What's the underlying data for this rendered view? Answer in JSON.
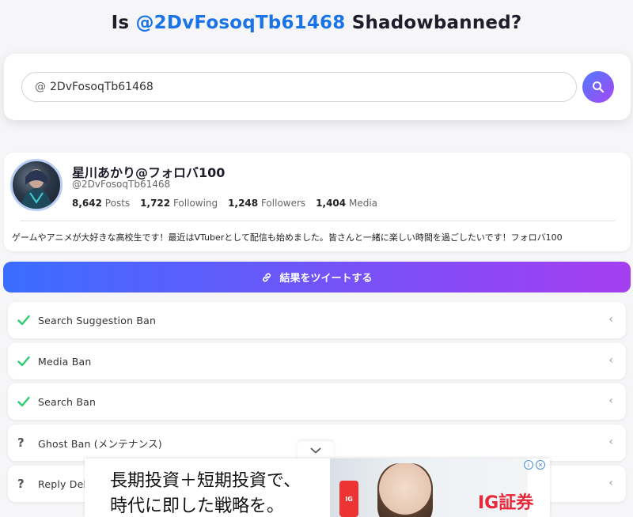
{
  "header": {
    "prefix": "Is",
    "handle": "@2DvFosoqTb61468",
    "suffix": "Shadowbanned?"
  },
  "search": {
    "at_symbol": "@",
    "value": "2DvFosoqTb61468"
  },
  "profile": {
    "display_name": "星川あかり@フォロバ100",
    "screen_name": "@2DvFosoqTb61468",
    "stats": [
      {
        "value": "8,642",
        "label": "Posts"
      },
      {
        "value": "1,722",
        "label": "Following"
      },
      {
        "value": "1,248",
        "label": "Followers"
      },
      {
        "value": "1,404",
        "label": "Media"
      }
    ],
    "bio": "ゲームやアニメが大好きな高校生です！最近はVTuberとして配信も始めました。皆さんと一緒に楽しい時間を過ごしたいです！フォロバ100"
  },
  "tweet_button": {
    "label": "結果をツイートする"
  },
  "ban_checks": [
    {
      "status": "ok",
      "label": "Search Suggestion Ban"
    },
    {
      "status": "ok",
      "label": "Media Ban"
    },
    {
      "status": "ok",
      "label": "Search Ban"
    },
    {
      "status": "unknown",
      "label": "Ghost Ban (メンテナンス)"
    },
    {
      "status": "unknown",
      "label": "Reply Deboosting"
    }
  ],
  "ad": {
    "line1": "長期投資＋短期投資で、",
    "line2": "時代に即した戦略を。",
    "brand": "IG証券",
    "phone_text": "IG",
    "info_glyph": "i",
    "close_glyph": "✕"
  },
  "colors": {
    "accent": "#1a73e8",
    "check": "#2ecc71",
    "gradient_start": "#3a6dff",
    "gradient_end": "#a53ff0"
  }
}
